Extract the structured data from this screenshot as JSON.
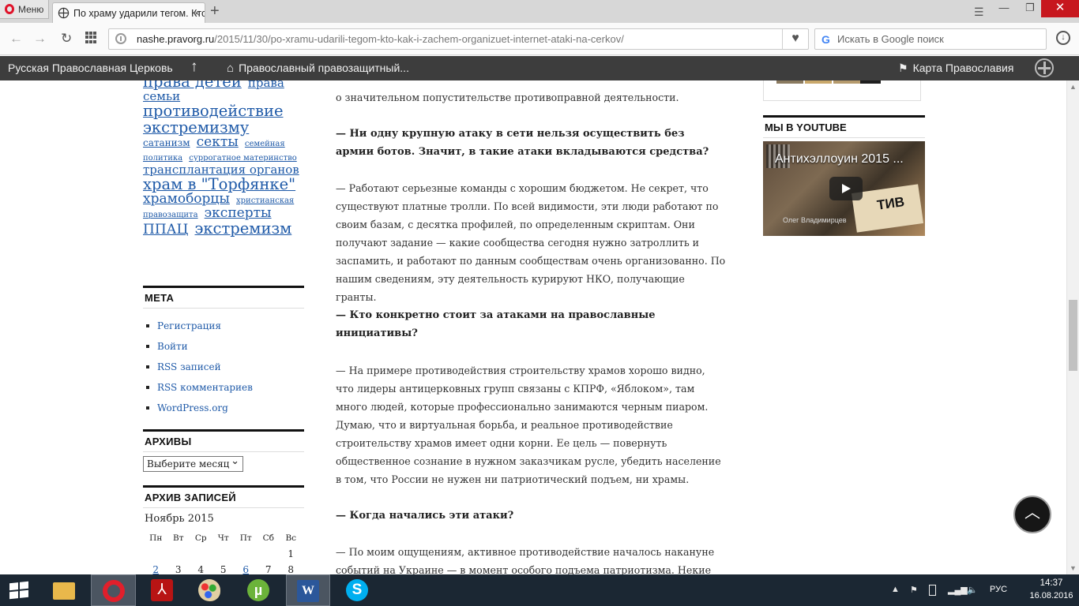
{
  "browser": {
    "menu_label": "Меню",
    "tab_title": "По храму ударили тегом. Кто",
    "tab_close": "×",
    "new_tab": "+",
    "url_domain": "nashe.pravorg.ru",
    "url_path": "/2015/11/30/po-xramu-udarili-tegom-kto-kak-i-zachem-organizuet-internet-ataki-na-cerkov/",
    "search_placeholder": "Искать в Google поиск",
    "win_min": "—",
    "win_max": "❐",
    "win_close": "✕"
  },
  "bookmarks": [
    {
      "label": "Русская Православная Церковь"
    },
    {
      "label": "Православный правозащитный..."
    },
    {
      "label": "Карта Православия"
    }
  ],
  "tag_cloud": [
    {
      "label": "права детей",
      "size": "xl"
    },
    {
      "label": "права семьи",
      "size": "m"
    },
    {
      "label": "противодействие экстремизму",
      "size": "xl"
    },
    {
      "label": "сатанизм",
      "size": "s"
    },
    {
      "label": "секты",
      "size": "l"
    },
    {
      "label": "семейная политика",
      "size": "xs"
    },
    {
      "label": "суррогатное материнство",
      "size": "xs"
    },
    {
      "label": "трансплантация органов",
      "size": "m"
    },
    {
      "label": "храм в \"Торфянке\"",
      "size": "xl"
    },
    {
      "label": "храмоборцы",
      "size": "l"
    },
    {
      "label": "христианская правозащита",
      "size": "xs"
    },
    {
      "label": "эксперты ППАЦ",
      "size": "l"
    },
    {
      "label": "экстремизм",
      "size": "xl"
    }
  ],
  "meta": {
    "title": "МЕТА",
    "items": [
      "Регистрация",
      "Войти",
      "RSS записей",
      "RSS комментариев",
      "WordPress.org"
    ]
  },
  "archives": {
    "title": "АРХИВЫ",
    "select_value": "Выберите месяц"
  },
  "archive_records": {
    "title": "АРХИВ ЗАПИСЕЙ",
    "caption": "Ноябрь 2015",
    "weekdays": [
      "Пн",
      "Вт",
      "Ср",
      "Чт",
      "Пт",
      "Сб",
      "Вс"
    ],
    "row1": [
      "",
      "",
      "",
      "",
      "",
      "",
      "1"
    ],
    "row2": [
      "2",
      "3",
      "4",
      "5",
      "6",
      "7",
      "8"
    ],
    "linked_days": [
      "2",
      "6"
    ]
  },
  "article": {
    "paragraphs": [
      {
        "type": "text",
        "text": "о значительном попустительстве противоправной деятельности."
      },
      {
        "type": "question",
        "text": "— Ни одну крупную атаку в сети нельзя осуществить без армии ботов. Значит, в такие атаки вкладываются средства?"
      },
      {
        "type": "text",
        "text": "— Работают серьезные команды с хорошим бюджетом. Не секрет, что существуют платные тролли. По всей видимости, эти люди работают по своим базам, с десятка профилей, по определенным скриптам. Они получают задание — какие сообщества сегодня нужно затроллить и заспамить, и работают по данным сообществам очень организованно. По нашим сведениям, эту деятельность курируют НКО, получающие гранты."
      },
      {
        "type": "question",
        "text": "— Кто конкретно стоит за атаками на православные инициативы?"
      },
      {
        "type": "text",
        "text": "— На примере противодействия строительству храмов хорошо видно, что лидеры антицерковных групп связаны с КПРФ, «Яблоком», там много людей, которые профессионально занимаются черным пиаром. Думаю, что и виртуальная борьба, и реальное противодействие строительству храмов имеет одни корни. Ее цель — повернуть общественное сознание в нужном заказчикам русле, убедить население в том, что России не нужен ни патриотический подъем, ни храмы."
      },
      {
        "type": "question",
        "text": "— Когда начались эти атаки?"
      },
      {
        "type": "text",
        "text": "— По моим ощущениям, активное противодействие началось накануне событий на Украине — в момент особого подъема патриотизма. Некие"
      }
    ]
  },
  "youtube": {
    "title": "МЫ В YOUTUBE",
    "video_title": "Антихэллоуин 2015 ...",
    "poster_text": "ТИВ",
    "caption": "Олег Владимирцев"
  },
  "to_top_icon": "chevron-up-icon",
  "taskbar": {
    "apps": [
      "explorer",
      "opera",
      "acrobat",
      "paint",
      "utorrent",
      "word",
      "skype"
    ],
    "word_glyph": "W",
    "skype_glyph": "S",
    "torrent_glyph": "µ",
    "acrobat_glyph": "⅄",
    "lang": "РУС",
    "time": "14:37",
    "date": "16.08.2016"
  }
}
